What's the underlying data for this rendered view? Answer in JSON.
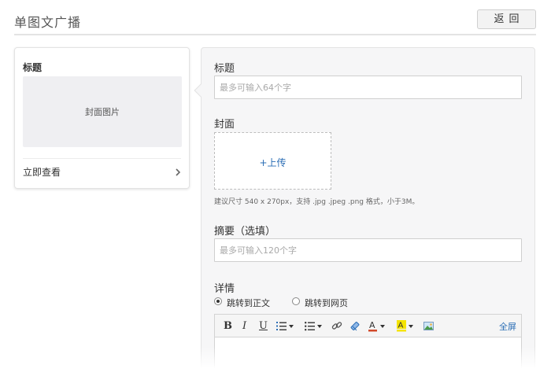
{
  "header": {
    "title": "单图文广播",
    "back_label": "返回"
  },
  "preview": {
    "title": "标题",
    "cover_text": "封面图片",
    "view_label": "立即查看"
  },
  "form": {
    "title_label": "标题",
    "title_placeholder": "最多可输入64个字",
    "cover_label": "封面",
    "upload_label": "+上传",
    "cover_hint": "建议尺寸 540 x 270px，支持 .jpg .jpeg .png 格式，小于3M。",
    "summary_label": "摘要（选填）",
    "summary_placeholder": "最多可输入120个字",
    "detail_label": "详情",
    "radio_options": [
      {
        "label": "跳转到正文",
        "selected": true
      },
      {
        "label": "跳转到网页",
        "selected": false
      }
    ]
  },
  "toolbar": {
    "bold": "B",
    "italic": "I",
    "underline": "U",
    "icons": [
      "bold-icon",
      "italic-icon",
      "underline-icon",
      "ordered-list-icon",
      "unordered-list-icon",
      "link-icon",
      "eraser-icon",
      "font-color-icon",
      "highlight-icon",
      "image-icon"
    ],
    "fullscreen_label": "全屏"
  },
  "colors": {
    "link": "#2a6db5",
    "panel_bg": "#f6f6f7",
    "border": "#e3e3e3",
    "font_color": "#d24a2b",
    "highlight": "#f5e400"
  }
}
